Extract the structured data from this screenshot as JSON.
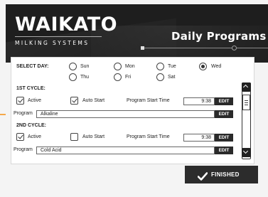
{
  "header": {
    "logo": "WAIKATO",
    "logo_sub": "MILKING SYSTEMS",
    "title": "Daily Programs"
  },
  "select_day": {
    "label": "SELECT DAY:",
    "days": [
      "Sun",
      "Mon",
      "Tue",
      "Wed",
      "Thu",
      "Fri",
      "Sat"
    ],
    "selected": "Wed"
  },
  "cycle1": {
    "heading": "1ST CYCLE:",
    "active_label": "Active",
    "active_checked": true,
    "auto_start_label": "Auto Start",
    "auto_start_checked": true,
    "start_time_label": "Program Start Time",
    "start_time": "9:38",
    "edit_time_label": "EDIT",
    "program_label": "Program",
    "program_value": "Alkaline",
    "edit_program_label": "EDIT"
  },
  "cycle2": {
    "heading": "2ND CYCLE:",
    "active_label": "Active",
    "active_checked": true,
    "auto_start_label": "Auto Start",
    "auto_start_checked": false,
    "start_time_label": "Program Start Time",
    "start_time": "9:38",
    "edit_time_label": "EDIT",
    "program_label": "Program",
    "program_value": "Cold Acid",
    "edit_program_label": "EDIT"
  },
  "footer": {
    "finished_label": "FINISHED"
  },
  "colors": {
    "header_bg": "#1e1e1e",
    "button_bg": "#2c2c2c",
    "accent": "#f5a84a"
  }
}
